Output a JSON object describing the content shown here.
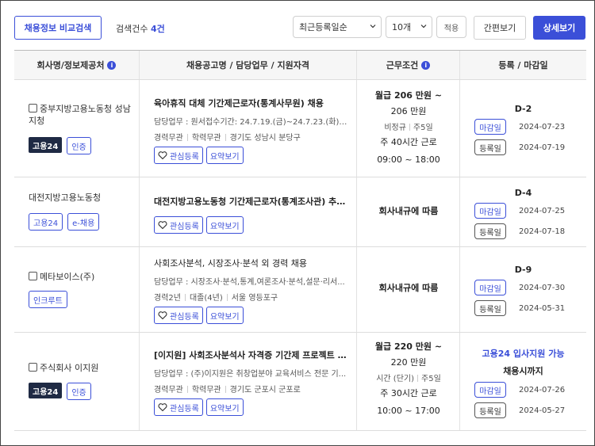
{
  "toolbar": {
    "compare_label": "채용정보 비교검색",
    "count_prefix": "검색건수",
    "count_value": "4건",
    "sort_value": "최근등록일순",
    "page_size_value": "10개",
    "apply_label": "적용",
    "simple_view_label": "간편보기",
    "detail_view_label": "상세보기"
  },
  "columns": {
    "company": "회사명/정보제공처",
    "job": "채용공고명 / 담당업무 / 지원자격",
    "condition": "근무조건",
    "dates": "등록 / 마감일"
  },
  "buttons": {
    "interest": "관심등록",
    "summary": "요약보기",
    "deadline_label": "마감일",
    "register_label": "등록일"
  },
  "rows": [
    {
      "company": "중부지방고용노동청 성남지청",
      "tags": [
        "고용24",
        "인증"
      ],
      "title": "육아휴직 대체 기간제근로자(통계사무원) 채용",
      "duty": "담당업무 : 원서접수기간: 24.7.19.(금)~24.7.23.(화) 1...",
      "meta": [
        "경력무관",
        "학력무관",
        "경기도 성남시 분당구"
      ],
      "pay_line1": "월급 206 만원 ~",
      "pay_line2": "206 만원",
      "type": [
        "비정규",
        "주5일"
      ],
      "hours1": "주 40시간 근로",
      "hours2": "09:00 ~ 18:00",
      "dday": "D-2",
      "deadline": "2024-07-23",
      "registered": "2024-07-19"
    },
    {
      "company": "대전지방고용노동청",
      "tags": [
        "고용24",
        "e-채용"
      ],
      "title": "대전지방고용노동청 기간제근로자(통계조사관) 추가...",
      "condition": "회사내규에 따름",
      "dday": "D-4",
      "deadline": "2024-07-25",
      "registered": "2024-07-18"
    },
    {
      "company": "메타보이스(주)",
      "tags": [
        "인크루트"
      ],
      "title": "사회조사분석, 시장조사·분석 외 경력 채용",
      "duty": "담당업무 : 시장조사·분석,통계,여론조사·분석,설문·리서...",
      "meta": [
        "경력2년",
        "대졸(4년)",
        "서울 영등포구"
      ],
      "condition": "회사내규에 따름",
      "dday": "D-9",
      "deadline": "2024-07-30",
      "registered": "2024-05-31"
    },
    {
      "company": "주식회사 이지원",
      "tags": [
        "고용24",
        "인증"
      ],
      "title": "[이지원] 사회조사분석사 자격증 기간제 프로젝트 사...",
      "duty": "담당업무 : (주)이지원은 취창업분야 교육서비스 전문 기...",
      "meta": [
        "경력무관",
        "학력무관",
        "경기도 군포시 군포로"
      ],
      "pay_line1": "월급 220 만원 ~",
      "pay_line2": "220 만원",
      "type": [
        "시간 (단기)",
        "주5일"
      ],
      "hours1": "주 30시간 근로",
      "hours2": "10:00 ~ 17:00",
      "dday": "고용24 입사지원 가능",
      "dday_sub": "채용시까지",
      "deadline": "2024-07-26",
      "registered": "2024-05-27"
    }
  ],
  "colors": {
    "accent": "#3b4fd8",
    "dark_tag": "#1f2a44"
  }
}
